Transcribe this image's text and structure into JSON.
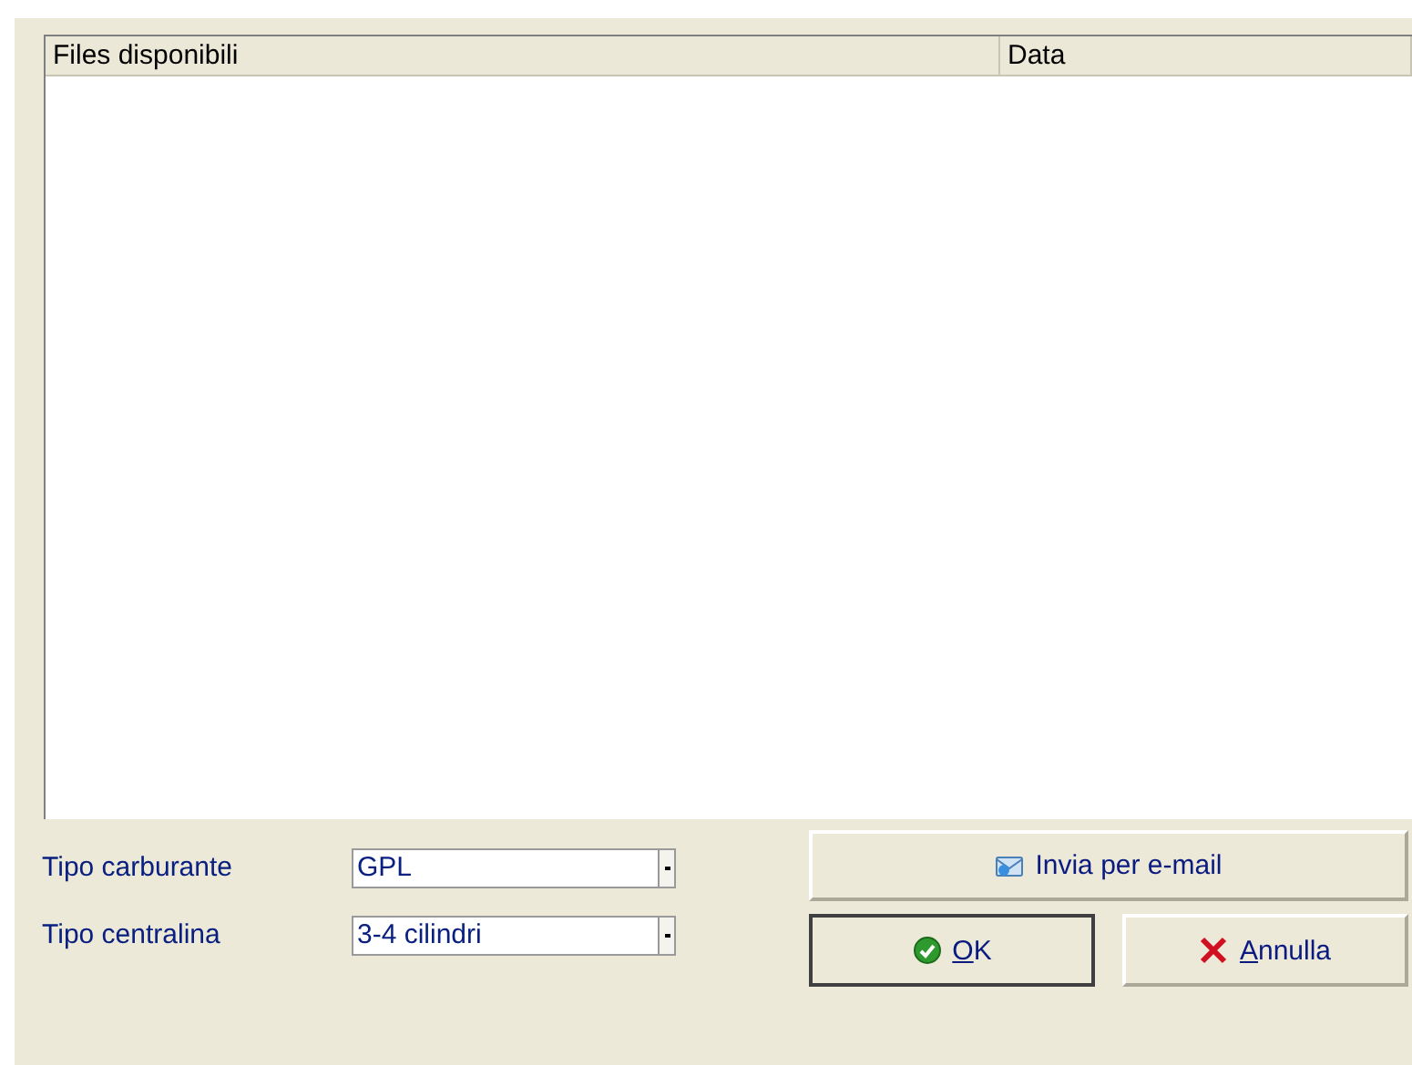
{
  "file_list": {
    "columns": [
      {
        "label": "Files disponibili"
      },
      {
        "label": "Data"
      }
    ]
  },
  "fields": [
    {
      "label": "Tipo carburante",
      "value": "GPL"
    },
    {
      "label": "Tipo centralina",
      "value": "3-4 cilindri"
    }
  ],
  "email_button": {
    "label": "Invia per e-mail"
  },
  "buttons": [
    {
      "kind": "ok",
      "label": "OK",
      "mnemonic": true,
      "default": true
    },
    {
      "kind": "cancel",
      "label": "Annulla",
      "mnemonic": true,
      "default": false
    }
  ]
}
